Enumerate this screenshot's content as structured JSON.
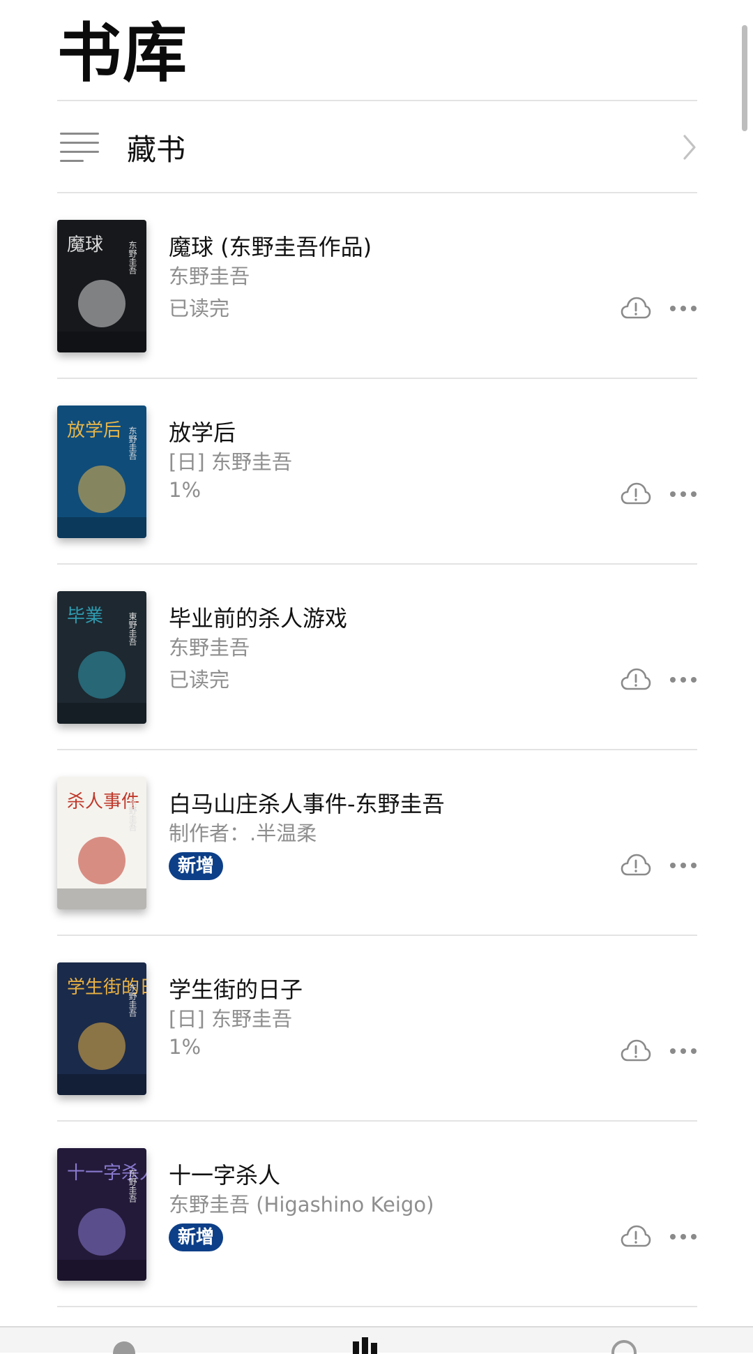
{
  "header": {
    "title": "书库"
  },
  "collection": {
    "label": "藏书"
  },
  "books": [
    {
      "title": "魔球 (东野圭吾作品)",
      "author": "东野圭吾",
      "status": "已读完",
      "badge": "",
      "cover": {
        "bg": "#16181c",
        "accent": "#d9d9d9",
        "text": "魔球",
        "label": "东野圭吾"
      }
    },
    {
      "title": "放学后",
      "author": "[日] 东野圭吾",
      "status": "1%",
      "badge": "",
      "cover": {
        "bg": "#0f4c7a",
        "accent": "#e7b64a",
        "text": "放学后",
        "label": "东野圭吾"
      }
    },
    {
      "title": "毕业前的杀人游戏",
      "author": "东野圭吾",
      "status": "已读完",
      "badge": "",
      "cover": {
        "bg": "#1d2830",
        "accent": "#2f9bb0",
        "text": "毕業",
        "label": "東野圭吾"
      }
    },
    {
      "title": "白马山庄杀人事件-东野圭吾",
      "author": "制作者：.半温柔",
      "status": "",
      "badge": "新增",
      "cover": {
        "bg": "#f5f3ee",
        "accent": "#c0392b",
        "text": "杀人事件",
        "label": "东野圭吾"
      }
    },
    {
      "title": "学生街的日子",
      "author": "[日] 东野圭吾",
      "status": "1%",
      "badge": "",
      "cover": {
        "bg": "#1a2a4a",
        "accent": "#e9b143",
        "text": "学生街的日子",
        "label": "东野圭吾"
      }
    },
    {
      "title": "十一字杀人",
      "author": "东野圭吾 (Higashino Keigo)",
      "status": "",
      "badge": "新增",
      "cover": {
        "bg": "#231a3a",
        "accent": "#8a7ad0",
        "text": "十一字杀人",
        "label": "东野圭吾"
      }
    }
  ],
  "colors": {
    "badge_bg": "#0d3f88",
    "secondary_text": "#8e8e8e"
  },
  "icons": {
    "collection": "list-lines-icon",
    "cloud": "cloud-alert-icon",
    "more": "more-dots-icon",
    "chevron": "chevron-right-icon"
  }
}
